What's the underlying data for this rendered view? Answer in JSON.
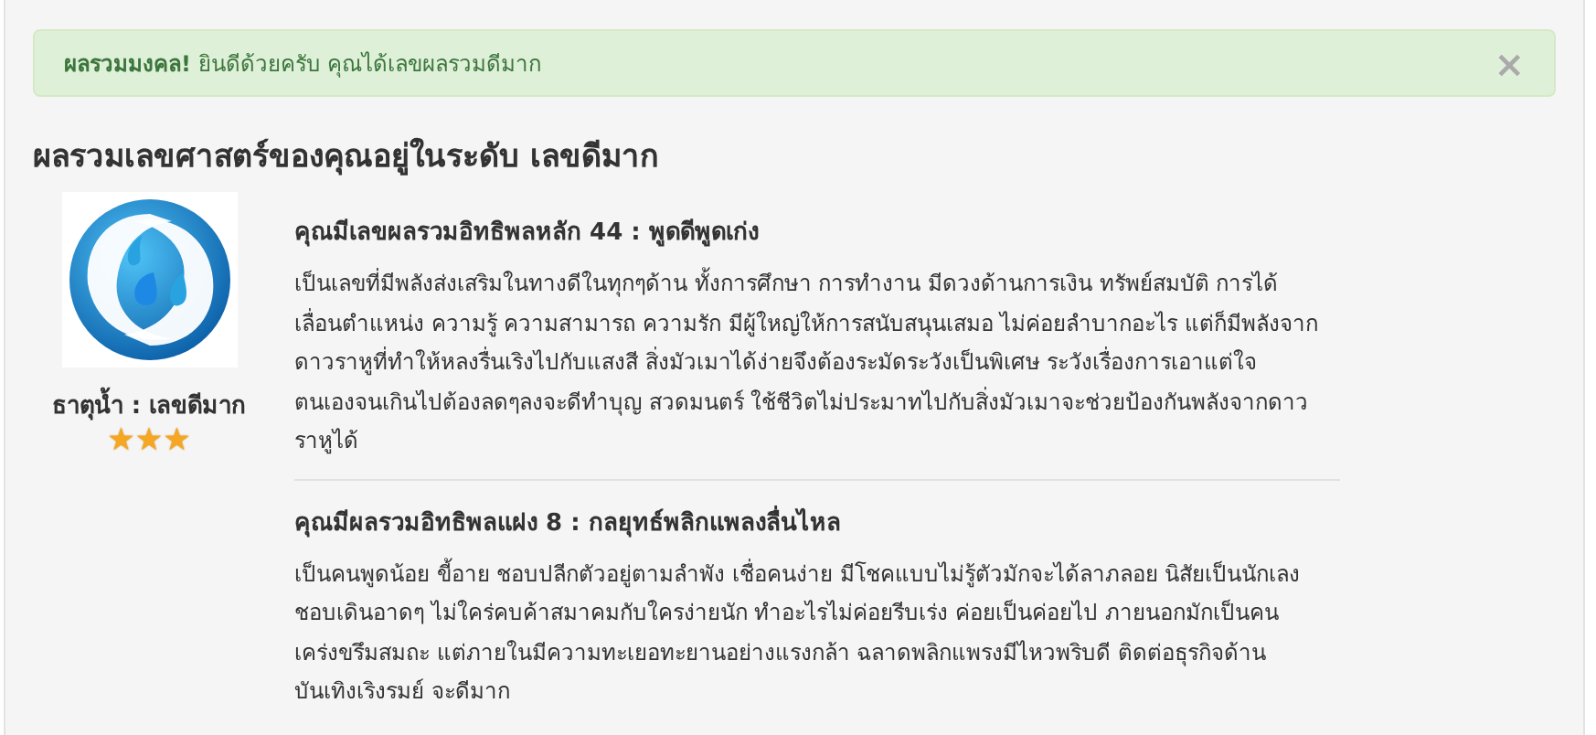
{
  "alert": {
    "title": "ผลรวมมงคล!",
    "message": "ยินดีด้วยครับ คุณได้เลขผลรวมดีมาก",
    "close": "×"
  },
  "heading": "ผลรวมเลขศาสตร์ของคุณอยู่ในระดับ เลขดีมาก",
  "element": {
    "caption": "ธาตุน้ำ : เลขดีมาก",
    "stars": 3
  },
  "sections": [
    {
      "title": "คุณมีเลขผลรวมอิทธิพลหลัก 44 : พูดดีพูดเก่ง",
      "lines": [
        "เป็นเลขที่มีพลังส่งเสริมในทางดีในทุกๆด้าน ทั้งการศึกษา การทำงาน มีดวงด้านการเงิน ทรัพย์สมบัติ การได้",
        "เลื่อนตำแหน่ง ความรู้ ความสามารถ ความรัก มีผู้ใหญ่ให้การสนับสนุนเสมอ ไม่ค่อยลำบากอะไร แต่ก็มีพลังจาก",
        "ดาวราหูที่ทำให้หลงรื่นเริงไปกับแสงสี สิ่งมัวเมาได้ง่ายจึงต้องระมัดระวังเป็นพิเศษ ระวังเรื่องการเอาแต่ใจ",
        "ตนเองจนเกินไปต้องลดๆลงจะดีทำบุญ สวดมนตร์ ใช้ชีวิตไม่ประมาทไปกับสิ่งมัวเมาจะช่วยป้องกันพลังจากดาว",
        "ราหูได้"
      ]
    },
    {
      "title": "คุณมีผลรวมอิทธิพลแฝง 8 : กลยุทธ์พลิกแพลงลื่นไหล",
      "lines": [
        "เป็นคนพูดน้อย ขี้อาย ชอบปลีกตัวอยู่ตามลำพัง เชื่อคนง่าย มีโชคแบบไม่รู้ตัวมักจะได้ลาภลอย นิสัยเป็นนักเลง",
        "ชอบเดินอาดๆ ไม่ใคร่คบค้าสมาคมกับใครง่ายนัก ทำอะไรไม่ค่อยรีบเร่ง ค่อยเป็นค่อยไป ภายนอกมักเป็นคน",
        "เคร่งขรึมสมถะ แต่ภายในมีความทะเยอทะยานอย่างแรงกล้า ฉลาดพลิกแพรงมีไหวพริบดี ติดต่อธุรกิจด้าน",
        "บันเทิงเริงรมย์ จะดีมาก"
      ]
    }
  ]
}
